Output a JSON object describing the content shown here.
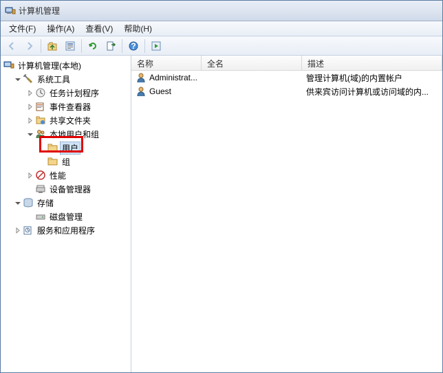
{
  "window": {
    "title": "计算机管理"
  },
  "menu": {
    "file": "文件(F)",
    "action": "操作(A)",
    "view": "查看(V)",
    "help": "帮助(H)"
  },
  "toolbar_icons": {
    "back": "nav-back",
    "forward": "nav-forward",
    "up": "nav-up",
    "show": "show-hide",
    "refresh": "refresh",
    "export": "export",
    "help": "help",
    "action": "run-action"
  },
  "tree": {
    "root": {
      "label": "计算机管理(本地)"
    },
    "system": {
      "label": "系统工具"
    },
    "task": {
      "label": "任务计划程序"
    },
    "event": {
      "label": "事件查看器"
    },
    "shared": {
      "label": "共享文件夹"
    },
    "usersgroups": {
      "label": "本地用户和组"
    },
    "users": {
      "label": "用户"
    },
    "groups": {
      "label": "组"
    },
    "perf": {
      "label": "性能"
    },
    "devmgr": {
      "label": "设备管理器"
    },
    "storage": {
      "label": "存储"
    },
    "diskmgmt": {
      "label": "磁盘管理"
    },
    "services": {
      "label": "服务和应用程序"
    }
  },
  "list": {
    "headers": {
      "name": "名称",
      "fullname": "全名",
      "desc": "描述"
    },
    "rows": [
      {
        "name": "Administrat...",
        "fullname": "",
        "desc": "管理计算机(域)的内置帐户"
      },
      {
        "name": "Guest",
        "fullname": "",
        "desc": "供来宾访问计算机或访问域的内..."
      }
    ]
  },
  "colors": {
    "highlight": "#e00000",
    "selection": "#cfe3f7"
  }
}
